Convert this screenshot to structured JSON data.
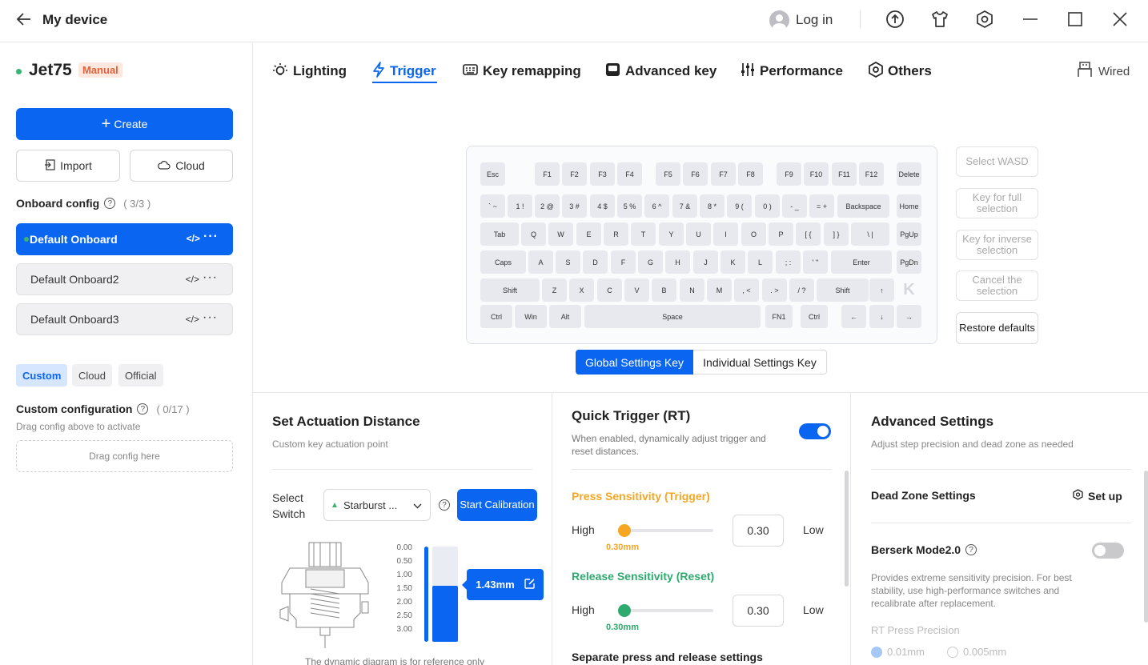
{
  "header": {
    "title": "My device",
    "login": "Log in"
  },
  "sidebar": {
    "device_name": "Jet75",
    "mode_badge": "Manual",
    "create": "Create",
    "import": "Import",
    "cloud": "Cloud",
    "onboard_title": "Onboard config",
    "onboard_count": "( 3/3 )",
    "onboard_items": [
      "Default Onboard",
      "Default Onboard2",
      "Default Onboard3"
    ],
    "filter_tabs": [
      "Custom",
      "Cloud",
      "Official"
    ],
    "custom_title": "Custom configuration",
    "custom_count": "( 0/17 )",
    "drag_hint": "Drag config above to activate",
    "drag_box": "Drag config here"
  },
  "tabs": [
    "Lighting",
    "Trigger",
    "Key remapping",
    "Advanced key",
    "Performance",
    "Others"
  ],
  "connection": "Wired",
  "keyboard": {
    "rows": [
      [
        "Esc",
        "F1",
        "F2",
        "F3",
        "F4",
        "F5",
        "F6",
        "F7",
        "F8",
        "F9",
        "F10",
        "F11",
        "F12",
        "Delete"
      ],
      [
        "` ~",
        "1 !",
        "2 @",
        "3 #",
        "4 $",
        "5 %",
        "6 ^",
        "7 &",
        "8 *",
        "9 (",
        "0 )",
        "- _",
        "= +",
        "Backspace",
        "Home"
      ],
      [
        "Tab",
        "Q",
        "W",
        "E",
        "R",
        "T",
        "Y",
        "U",
        "I",
        "O",
        "P",
        "[ {",
        "] }",
        "\\ |",
        "PgUp"
      ],
      [
        "Caps",
        "A",
        "S",
        "D",
        "F",
        "G",
        "H",
        "J",
        "K",
        "L",
        "; :",
        "' \"",
        "Enter",
        "PgDn"
      ],
      [
        "Shift",
        "Z",
        "X",
        "C",
        "V",
        "B",
        "N",
        "M",
        ", <",
        ". >",
        "/ ?",
        "Shift",
        "↑"
      ],
      [
        "Ctrl",
        "Win",
        "Alt",
        "Space",
        "FN1",
        "Ctrl",
        "←",
        "↓",
        "→"
      ]
    ],
    "logo": "K"
  },
  "side_buttons": [
    "Select WASD",
    "Key for full selection",
    "Key for inverse selection",
    "Cancel the selection",
    "Restore defaults"
  ],
  "settings_mode": [
    "Global Settings Key",
    "Individual Settings Key"
  ],
  "actuation": {
    "title": "Set Actuation Distance",
    "subtitle": "Custom key actuation point",
    "select_label": "Select Switch",
    "switch_value": "Starburst ...",
    "calibrate": "Start Calibration",
    "scale": [
      "0.00",
      "0.50",
      "1.00",
      "1.50",
      "2.00",
      "2.50",
      "3.00"
    ],
    "value": "1.43mm",
    "value_num": 1.43,
    "max_travel": 3.5,
    "footnote": "The dynamic diagram is for reference only"
  },
  "quick_trigger": {
    "title": "Quick Trigger (RT)",
    "desc": "When enabled, dynamically adjust trigger and reset distances.",
    "enabled": true,
    "press_title": "Press Sensitivity (Trigger)",
    "release_title": "Release Sensitivity (Reset)",
    "high": "High",
    "low": "Low",
    "press_value": "0.30",
    "press_caption": "0.30mm",
    "release_value": "0.30",
    "release_caption": "0.30mm",
    "separate": "Separate press and release settings",
    "colors": {
      "press": "#f5a623",
      "release": "#2eaa6e"
    }
  },
  "advanced": {
    "title": "Advanced Settings",
    "subtitle": "Adjust step precision and dead zone as needed",
    "dead_zone": "Dead Zone Settings",
    "setup": "Set up",
    "berserk": "Berserk Mode2.0",
    "berserk_enabled": false,
    "berserk_desc": "Provides extreme sensitivity precision. For best stability, use high-performance switches and recalibrate after replacement.",
    "rt_precision": "RT Press Precision",
    "precision_options": [
      "0.01mm",
      "0.005mm"
    ]
  },
  "accent": "#0a66f0"
}
